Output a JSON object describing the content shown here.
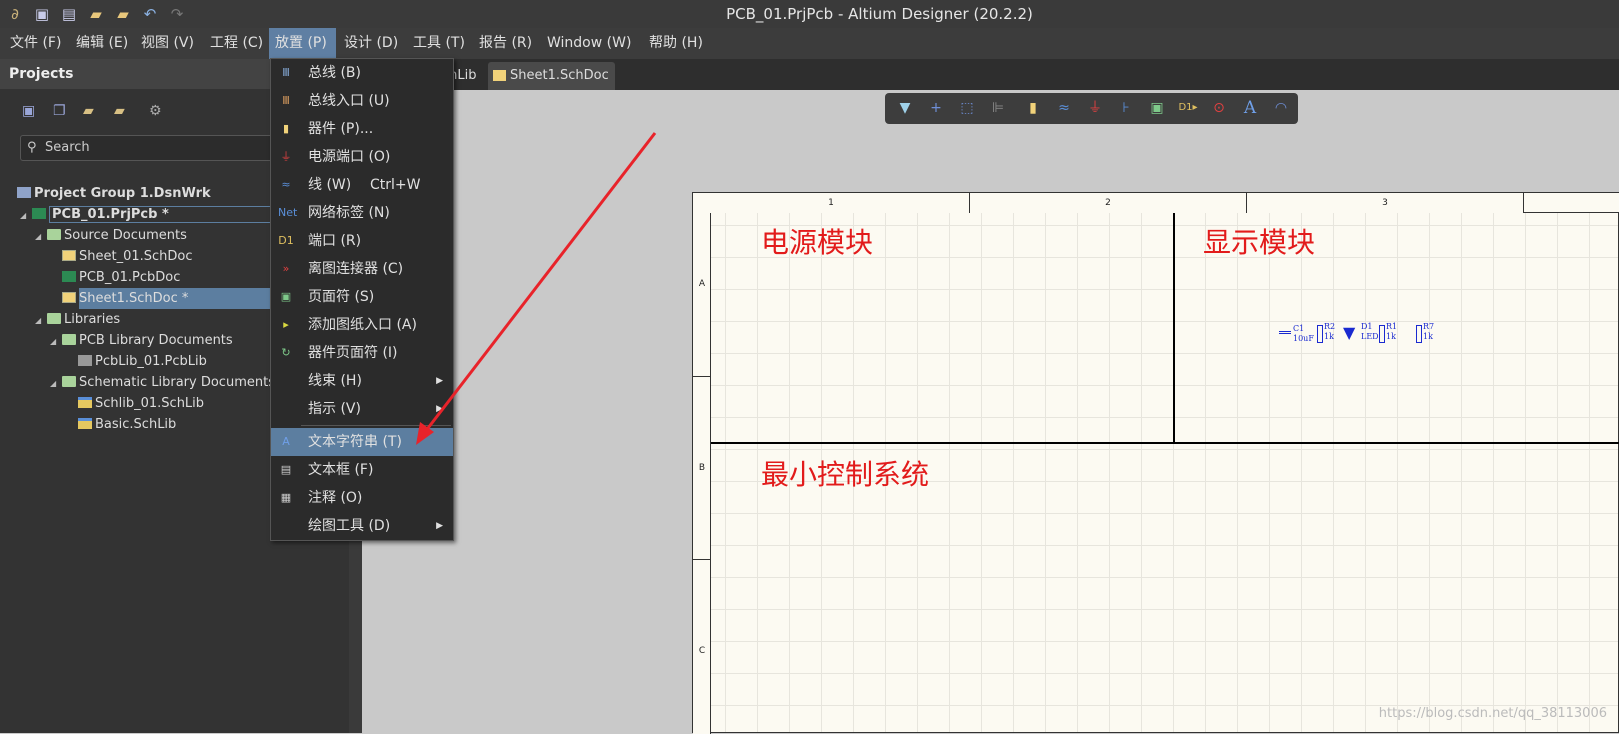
{
  "window": {
    "title": "PCB_01.PrjPcb - Altium Designer (20.2.2)"
  },
  "quick_access": [
    "app-logo-icon",
    "save-icon",
    "save-all-icon",
    "open-icon",
    "open-project-icon",
    "undo-icon",
    "redo-icon"
  ],
  "menu": [
    {
      "label": "文件 (F)"
    },
    {
      "label": "编辑 (E)"
    },
    {
      "label": "视图 (V)"
    },
    {
      "label": "工程 (C)"
    },
    {
      "label": "放置 (P)",
      "active": true
    },
    {
      "label": "设计 (D)"
    },
    {
      "label": "工具 (T)"
    },
    {
      "label": "报告 (R)"
    },
    {
      "label": "Window (W)"
    },
    {
      "label": "帮助 (H)"
    }
  ],
  "projects_panel": {
    "title": "Projects",
    "search_placeholder": "Search",
    "tree": [
      {
        "label": "Project Group 1.DsnWrk",
        "level": 0,
        "icon": "workspace-icon",
        "bold": true
      },
      {
        "label": "PCB_01.PrjPcb *",
        "level": 0,
        "icon": "pcb-project-icon",
        "bold": true,
        "expanded": true
      },
      {
        "label": "Source Documents",
        "level": 1,
        "icon": "folder-icon",
        "expanded": true
      },
      {
        "label": "Sheet_01.SchDoc",
        "level": 2,
        "icon": "schdoc-icon"
      },
      {
        "label": "PCB_01.PcbDoc",
        "level": 2,
        "icon": "pcbdoc-icon"
      },
      {
        "label": "Sheet1.SchDoc *",
        "level": 2,
        "icon": "schdoc-icon",
        "selected": true
      },
      {
        "label": "Libraries",
        "level": 1,
        "icon": "folder-icon",
        "expanded": true
      },
      {
        "label": "PCB Library Documents",
        "level": 2,
        "icon": "folder-icon",
        "expanded": true
      },
      {
        "label": "PcbLib_01.PcbLib",
        "level": 3,
        "icon": "pcblib-icon"
      },
      {
        "label": "Schematic Library Documents",
        "level": 2,
        "icon": "folder-icon",
        "expanded": true
      },
      {
        "label": "Schlib_01.SchLib",
        "level": 3,
        "icon": "schlib-icon"
      },
      {
        "label": "Basic.SchLib",
        "level": 3,
        "icon": "schlib-icon"
      }
    ]
  },
  "tabs": [
    {
      "label": "chLib"
    },
    {
      "label": "Sheet1.SchDoc *",
      "active": true
    }
  ],
  "place_menu": [
    {
      "label": "总线 (B)",
      "icon": "bus-icon"
    },
    {
      "label": "总线入口 (U)",
      "icon": "bus-entry-icon"
    },
    {
      "label": "器件 (P)...",
      "icon": "part-icon"
    },
    {
      "label": "电源端口 (O)",
      "icon": "power-port-icon"
    },
    {
      "label": "线 (W)",
      "shortcut": "Ctrl+W",
      "icon": "wire-icon"
    },
    {
      "label": "网络标签 (N)",
      "icon": "net-label-icon"
    },
    {
      "label": "端口 (R)",
      "icon": "port-icon"
    },
    {
      "label": "离图连接器 (C)",
      "icon": "off-sheet-connector-icon"
    },
    {
      "label": "页面符 (S)",
      "icon": "sheet-symbol-icon"
    },
    {
      "label": "添加图纸入口 (A)",
      "icon": "sheet-entry-icon"
    },
    {
      "label": "器件页面符 (I)",
      "icon": "device-sheet-symbol-icon"
    },
    {
      "label": "线束 (H)",
      "submenu": true
    },
    {
      "label": "指示 (V)",
      "submenu": true
    },
    {
      "label": "文本字符串 (T)",
      "icon": "text-string-icon",
      "highlighted": true
    },
    {
      "label": "文本框 (F)",
      "icon": "text-frame-icon"
    },
    {
      "label": "注释 (O)",
      "icon": "note-icon"
    },
    {
      "label": "绘图工具 (D)",
      "submenu": true
    }
  ],
  "schematic": {
    "columns": [
      "1",
      "2",
      "3"
    ],
    "rows": [
      "A",
      "B",
      "C"
    ],
    "regions": [
      "电源模块",
      "显示模块",
      "最小控制系统"
    ],
    "components": [
      {
        "ref": "C1",
        "value": "10uF"
      },
      {
        "ref": "R2",
        "value": "1k"
      },
      {
        "ref": "D1",
        "value": "LED"
      },
      {
        "ref": "R1",
        "value": "1k"
      },
      {
        "ref": "R7",
        "value": "1k"
      }
    ]
  },
  "watermark": "https://blog.csdn.net/qq_38113006",
  "colors": {
    "accent": "#5c7ea0",
    "annotation": "#e21b1b",
    "component": "#1a2ad0"
  }
}
